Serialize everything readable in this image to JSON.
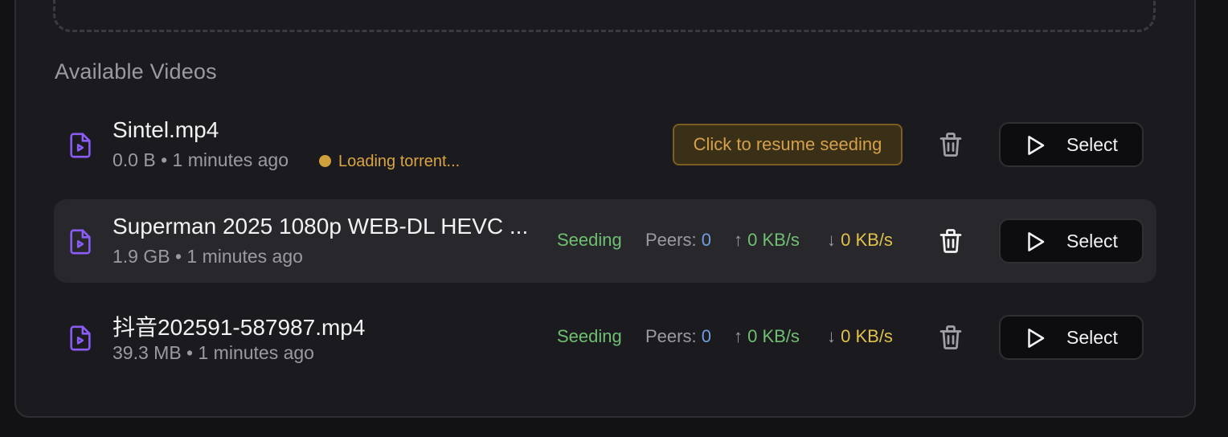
{
  "section": {
    "title": "Available Videos"
  },
  "videos": [
    {
      "name": "Sintel.mp4",
      "meta": "0.0 B • 1 minutes ago",
      "loading": "Loading torrent...",
      "resume_label": "Click to resume seeding",
      "select_label": "Select"
    },
    {
      "name": "Superman 2025 1080p WEB-DL HEVC ...",
      "meta": "1.9 GB • 1 minutes ago",
      "status": "Seeding",
      "peers_label": "Peers:",
      "peers": "0",
      "up_arrow": "↑",
      "up": "0 KB/s",
      "down_arrow": "↓",
      "down": "0 KB/s",
      "select_label": "Select"
    },
    {
      "name": "抖音202591-587987.mp4",
      "meta": "39.3 MB • 1 minutes ago",
      "status": "Seeding",
      "peers_label": "Peers:",
      "peers": "0",
      "up_arrow": "↑",
      "up": "0 KB/s",
      "down_arrow": "↓",
      "down": "0 KB/s",
      "select_label": "Select"
    }
  ],
  "colors": {
    "background": "#1b1b1f",
    "accent_icon": "#8b5cf6",
    "seeding": "#6fbf73",
    "peers_value": "#6f9fe0",
    "download": "#e0c04a",
    "loading": "#d0a13a"
  },
  "icons": {
    "file": "video-file-icon",
    "trash": "trash-icon",
    "play": "play-icon"
  }
}
